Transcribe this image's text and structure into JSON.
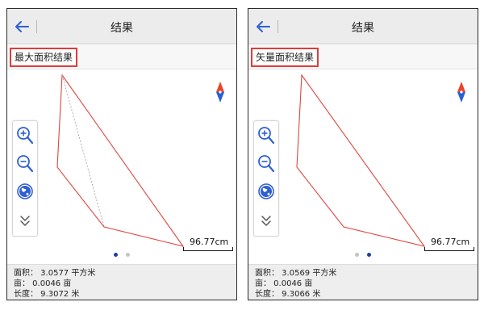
{
  "screens": [
    {
      "header": {
        "title": "结果"
      },
      "subtitle": "最大面积结果",
      "scale_label": "96.77cm",
      "pager": {
        "count": 2,
        "active": 0
      },
      "stats": {
        "area": "面积： 3.0577 平方米",
        "mu": "亩： 0.0046 亩",
        "length": "长度： 9.3072 米"
      },
      "icons": {
        "back": "back-arrow-icon",
        "compass": "compass-icon",
        "zoom_in": "zoom-in-icon",
        "zoom_out": "zoom-out-icon",
        "globe": "globe-icon",
        "expand": "double-chevron-down-icon"
      }
    },
    {
      "header": {
        "title": "结果"
      },
      "subtitle": "矢量面积结果",
      "scale_label": "96.77cm",
      "pager": {
        "count": 2,
        "active": 1
      },
      "stats": {
        "area": "面积： 3.0569 平方米",
        "mu": "亩： 0.0046 亩",
        "length": "长度： 9.3066 米"
      },
      "icons": {
        "back": "back-arrow-icon",
        "compass": "compass-icon",
        "zoom_in": "zoom-in-icon",
        "zoom_out": "zoom-out-icon",
        "globe": "globe-icon",
        "expand": "double-chevron-down-icon"
      }
    }
  ],
  "colors": {
    "polygon_stroke": "#e0443f",
    "highlight_border": "#e23b3b",
    "back_arrow": "#2f5fd3",
    "pager_active": "#1e3f99",
    "pager_inactive": "#c4c4c4",
    "compass_north": "#e8452c",
    "compass_south": "#2a5fd6"
  }
}
